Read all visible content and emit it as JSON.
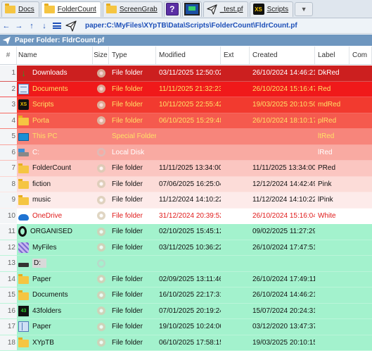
{
  "tabs": [
    {
      "label": "Docs",
      "icon": "folder-icon",
      "kind": "folder"
    },
    {
      "label": "FolderCount",
      "icon": "folder-icon",
      "kind": "folder"
    },
    {
      "label": "ScreenGrab",
      "icon": "folder-icon",
      "kind": "folder"
    },
    {
      "label": "",
      "icon": "help-icon",
      "kind": "help"
    },
    {
      "label": "",
      "icon": "monitor-icon",
      "kind": "monitor"
    },
    {
      "label": "_test.pf",
      "icon": "paper-plane-icon",
      "kind": "plane"
    },
    {
      "label": "Scripts",
      "icon": "xs-script-icon",
      "kind": "xs"
    }
  ],
  "nav": {
    "path": "paper:C:\\MyFiles\\XYpTB\\Data\\Scripts\\FolderCount\\FldrCount.pf"
  },
  "title": "Paper Folder: FldrCount.pf",
  "columns": {
    "num": "#",
    "name": "Name",
    "size": "Size",
    "type": "Type",
    "modified": "Modified",
    "ext": "Ext",
    "created": "Created",
    "label": "Label",
    "comment": "Com"
  },
  "rows": [
    {
      "num": "1",
      "name": "Downloads",
      "icon": "download-icon",
      "type": "File folder",
      "modified": "03/11/2025 12:50:02",
      "created": "26/10/2024 14:46:21",
      "label": "DkRed",
      "bg": "#cc1f1f",
      "fg": "#ffffff",
      "dateFg": "#ffffff",
      "dot": "solid"
    },
    {
      "num": "2",
      "name": "Documents",
      "icon": "document-icon",
      "type": "File folder",
      "modified": "11/11/2025 21:32:23",
      "created": "26/10/2024 15:16:47",
      "label": "Red",
      "bg": "#f0191a",
      "fg": "#ffe066",
      "dateFg": "#ffe066",
      "dot": "solid"
    },
    {
      "num": "3",
      "name": "Scripts",
      "icon": "xs-script-icon",
      "type": "File folder",
      "modified": "10/11/2025 22:55:42",
      "created": "19/03/2025 20:10:50",
      "label": "mdRed",
      "bg": "#f23a2f",
      "fg": "#ffe066",
      "dateFg": "#ffe066",
      "dot": "solid"
    },
    {
      "num": "4",
      "name": "Porta",
      "icon": "folder-icon",
      "type": "File folder",
      "modified": "06/10/2025 15:29:48",
      "created": "26/10/2024 18:10:17",
      "label": "plRed",
      "bg": "#f55a4e",
      "fg": "#ffe066",
      "dateFg": "#ffe066",
      "dot": "solid"
    },
    {
      "num": "5",
      "name": "This PC",
      "icon": "computer-icon",
      "type": "Special Folder",
      "modified": "",
      "created": "",
      "label": "ltRed",
      "bg": "#f7857b",
      "fg": "#ffe066",
      "dateFg": "#ffe066",
      "dot": "none"
    },
    {
      "num": "6",
      "name": "C:",
      "icon": "drive-icon",
      "type": "Local Disk",
      "modified": "",
      "created": "",
      "label": "lRed",
      "bg": "#f9aaa2",
      "fg": "#ffffff",
      "dateFg": "#ffffff",
      "dot": "faint"
    },
    {
      "num": "7",
      "name": "FolderCount",
      "icon": "folder-icon",
      "type": "File folder",
      "modified": "11/11/2025 13:34:00",
      "created": "11/11/2025 13:34:00",
      "label": "PRed",
      "bg": "#fbc6c1",
      "fg": "#111111",
      "dateFg": "#111111",
      "dot": "solid"
    },
    {
      "num": "8",
      "name": "fiction",
      "icon": "folder-icon",
      "type": "File folder",
      "modified": "07/06/2025 16:25:04",
      "created": "12/12/2024 14:42:49",
      "label": "Pink",
      "bg": "#fcdcd8",
      "fg": "#111111",
      "dateFg": "#111111",
      "dot": "solid"
    },
    {
      "num": "9",
      "name": "music",
      "icon": "folder-icon",
      "type": "File folder",
      "modified": "11/12/2024 14:10:22",
      "created": "11/12/2024 14:10:22",
      "label": "lPink",
      "bg": "#fdebea",
      "fg": "#111111",
      "dateFg": "#111111",
      "dot": "solid"
    },
    {
      "num": "10",
      "name": "OneDrive",
      "icon": "cloud-icon",
      "type": "File folder",
      "modified": "31/12/2024 20:39:52",
      "created": "26/10/2024 15:16:04",
      "label": "White",
      "bg": "#ffffff",
      "fg": "#e01a1a",
      "dateFg": "#e01a1a",
      "dot": "solid"
    },
    {
      "num": "11",
      "name": "ORGANISED",
      "icon": "organised-icon",
      "type": "File folder",
      "modified": "02/10/2025 15:45:12",
      "created": "09/02/2025 11:27:29",
      "label": "",
      "bg": "#a3f2cd",
      "fg": "#111111",
      "dateFg": "#111111",
      "dot": "solid"
    },
    {
      "num": "12",
      "name": "MyFiles",
      "icon": "myfiles-icon",
      "type": "File folder",
      "modified": "03/11/2025 10:36:22",
      "created": "26/10/2024 17:47:51",
      "label": "",
      "bg": "#a3f2cd",
      "fg": "#111111",
      "dateFg": "#111111",
      "dot": "solid"
    },
    {
      "num": "13",
      "name": "D:",
      "icon": "drive-d-icon",
      "type": "",
      "modified": "",
      "created": "",
      "label": "",
      "bg": "#a3f2cd",
      "fg": "#111111",
      "dateFg": "#111111",
      "dot": "faint",
      "boxed": true
    },
    {
      "num": "14",
      "name": "Paper",
      "icon": "folder-icon",
      "type": "File folder",
      "modified": "02/09/2025 13:11:46",
      "created": "26/10/2024 17:49:11",
      "label": "",
      "bg": "#a3f2cd",
      "fg": "#111111",
      "dateFg": "#111111",
      "dot": "solid"
    },
    {
      "num": "15",
      "name": "Documents",
      "icon": "folder-icon",
      "type": "File folder",
      "modified": "16/10/2025 22:17:31",
      "created": "26/10/2024 14:46:21",
      "label": "",
      "bg": "#a3f2cd",
      "fg": "#111111",
      "dateFg": "#111111",
      "dot": "solid"
    },
    {
      "num": "16",
      "name": "43folders",
      "icon": "43folders-icon",
      "type": "File folder",
      "modified": "07/01/2025 20:19:24",
      "created": "15/07/2024 20:24:31",
      "label": "",
      "bg": "#a3f2cd",
      "fg": "#111111",
      "dateFg": "#111111",
      "dot": "solid"
    },
    {
      "num": "17",
      "name": "Paper",
      "icon": "paper-icon",
      "type": "File folder",
      "modified": "19/10/2025 10:24:06",
      "created": "03/12/2020 13:47:37",
      "label": "",
      "bg": "#a3f2cd",
      "fg": "#111111",
      "dateFg": "#111111",
      "dot": "solid"
    },
    {
      "num": "18",
      "name": "XYpTB",
      "icon": "folder-icon",
      "type": "File folder",
      "modified": "06/10/2025 17:58:15",
      "created": "19/03/2025 20:10:15",
      "label": "",
      "bg": "#a3f2cd",
      "fg": "#111111",
      "dateFg": "#111111",
      "dot": "solid"
    }
  ]
}
